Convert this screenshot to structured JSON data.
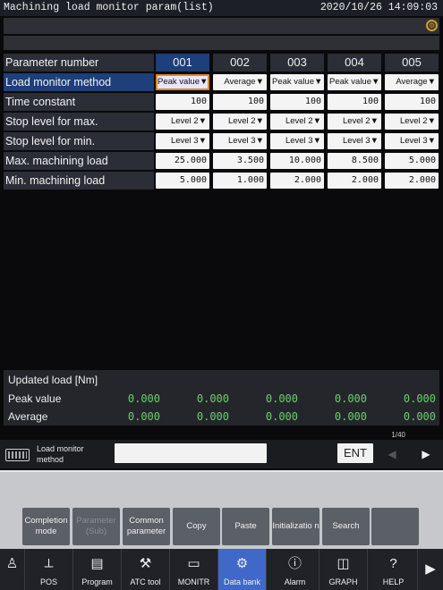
{
  "header": {
    "title": "Machining load monitor param(list)",
    "datetime": "2020/10/26 14:09:03"
  },
  "table": {
    "param_header": "Parameter number",
    "columns": [
      "001",
      "002",
      "003",
      "004",
      "005"
    ],
    "rows": [
      {
        "label": "Load monitor method",
        "cells": [
          "Peak value▼",
          "Average▼",
          "Peak value▼",
          "Peak value▼",
          "Average▼"
        ]
      },
      {
        "label": "Time constant",
        "cells": [
          "100",
          "100",
          "100",
          "100",
          "100"
        ]
      },
      {
        "label": "Stop level for max.",
        "cells": [
          "Level 2▼",
          "Level 2▼",
          "Level 2▼",
          "Level 2▼",
          "Level 2▼"
        ]
      },
      {
        "label": "Stop level for min.",
        "cells": [
          "Level 3▼",
          "Level 3▼",
          "Level 3▼",
          "Level 3▼",
          "Level 3▼"
        ]
      },
      {
        "label": "Max. machining load",
        "cells": [
          "25.000",
          "3.500",
          "10.000",
          "8.500",
          "5.000"
        ]
      },
      {
        "label": "Min. machining load",
        "cells": [
          "5.000",
          "1.000",
          "2.000",
          "2.000",
          "2.000"
        ]
      }
    ]
  },
  "updated_load": {
    "title": "Updated load [Nm]",
    "peak_label": "Peak value",
    "avg_label": "Average",
    "peak_values": [
      "0.000",
      "0.000",
      "0.000",
      "0.000",
      "0.000"
    ],
    "avg_values": [
      "0.000",
      "0.000",
      "0.000",
      "0.000",
      "0.000"
    ]
  },
  "input": {
    "page": "1/40",
    "label_line1": "Load monitor",
    "label_line2": "method",
    "ent": "ENT"
  },
  "softkeys": [
    {
      "label": "Completion mode",
      "enabled": true
    },
    {
      "label": "Parameter (Sub)",
      "enabled": false
    },
    {
      "label": "Common parameter",
      "enabled": true
    },
    {
      "label": "Copy",
      "enabled": true
    },
    {
      "label": "Paste",
      "enabled": true
    },
    {
      "label": "Initializatio n",
      "enabled": true
    },
    {
      "label": "Search",
      "enabled": true
    },
    {
      "label": "",
      "enabled": true
    }
  ],
  "bottom_nav": [
    {
      "label": "",
      "icon": "machine-icon"
    },
    {
      "label": "POS",
      "icon": "axis-icon"
    },
    {
      "label": "Program",
      "icon": "program-icon"
    },
    {
      "label": "ATC tool",
      "icon": "atc-icon"
    },
    {
      "label": "MONITR",
      "icon": "monitor-icon"
    },
    {
      "label": "Data bank",
      "icon": "gear-icon",
      "active": true
    },
    {
      "label": "Alarm",
      "icon": "alarm-icon"
    },
    {
      "label": "GRAPH",
      "icon": "graph-icon"
    },
    {
      "label": "HELP",
      "icon": "help-icon"
    }
  ],
  "colors": {
    "accent": "#3f68c9",
    "selected_row": "#1d3f7a",
    "value_green": "#6ccf6c",
    "focus": "#e08820"
  }
}
